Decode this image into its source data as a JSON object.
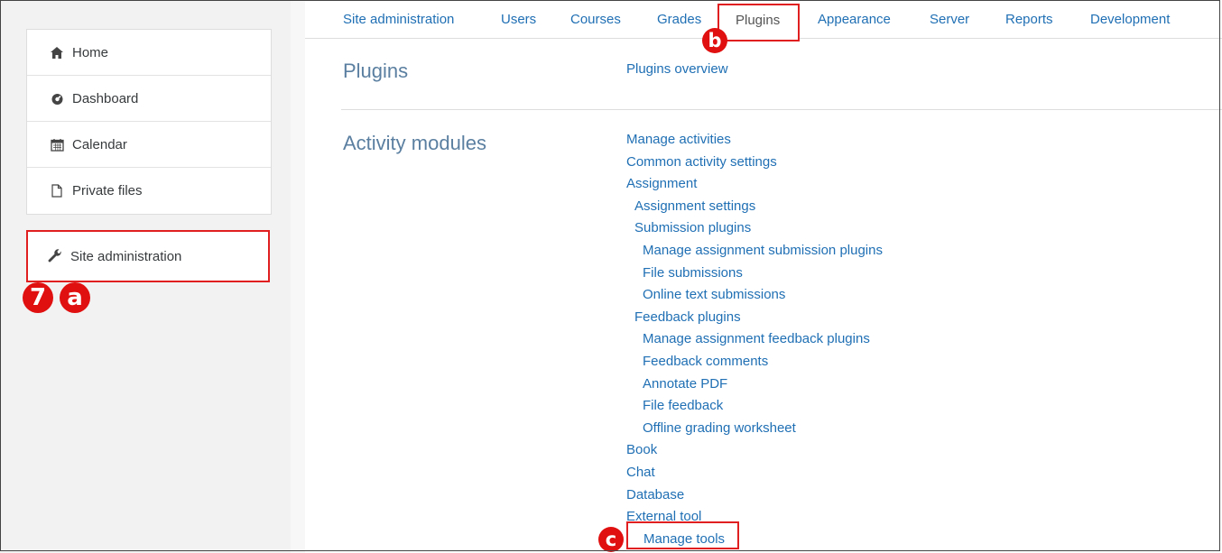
{
  "sidebar": {
    "nav_items": [
      {
        "label": "Home",
        "icon": "home-icon"
      },
      {
        "label": "Dashboard",
        "icon": "dashboard-icon"
      },
      {
        "label": "Calendar",
        "icon": "calendar-icon"
      },
      {
        "label": "Private files",
        "icon": "file-icon"
      }
    ],
    "site_admin": {
      "label": "Site administration",
      "icon": "wrench-icon"
    }
  },
  "annotations": {
    "step_number": "7",
    "marker_a": "a",
    "marker_b": "b",
    "marker_c": "c",
    "highlight_color": "#e02020"
  },
  "tabs": [
    "Site administration",
    "Users",
    "Courses",
    "Grades",
    "Plugins",
    "Appearance",
    "Server",
    "Reports",
    "Development"
  ],
  "sections": {
    "plugins": {
      "title": "Plugins",
      "links": [
        "Plugins overview"
      ]
    },
    "activity_modules": {
      "title": "Activity modules",
      "links": [
        {
          "label": "Manage activities",
          "level": 0
        },
        {
          "label": "Common activity settings",
          "level": 0
        },
        {
          "label": "Assignment",
          "level": 0
        },
        {
          "label": "Assignment settings",
          "level": 1
        },
        {
          "label": "Submission plugins",
          "level": 1
        },
        {
          "label": "Manage assignment submission plugins",
          "level": 2
        },
        {
          "label": "File submissions",
          "level": 2
        },
        {
          "label": "Online text submissions",
          "level": 2
        },
        {
          "label": "Feedback plugins",
          "level": 1
        },
        {
          "label": "Manage assignment feedback plugins",
          "level": 2
        },
        {
          "label": "Feedback comments",
          "level": 2
        },
        {
          "label": "Annotate PDF",
          "level": 2
        },
        {
          "label": "File feedback",
          "level": 2
        },
        {
          "label": "Offline grading worksheet",
          "level": 2
        },
        {
          "label": "Book",
          "level": 0
        },
        {
          "label": "Chat",
          "level": 0
        },
        {
          "label": "Database",
          "level": 0
        },
        {
          "label": "External tool",
          "level": 0
        },
        {
          "label": "Manage tools",
          "level": 1
        }
      ]
    }
  },
  "colors": {
    "link": "#1f6fb4",
    "section_title": "#5a7fa0"
  }
}
